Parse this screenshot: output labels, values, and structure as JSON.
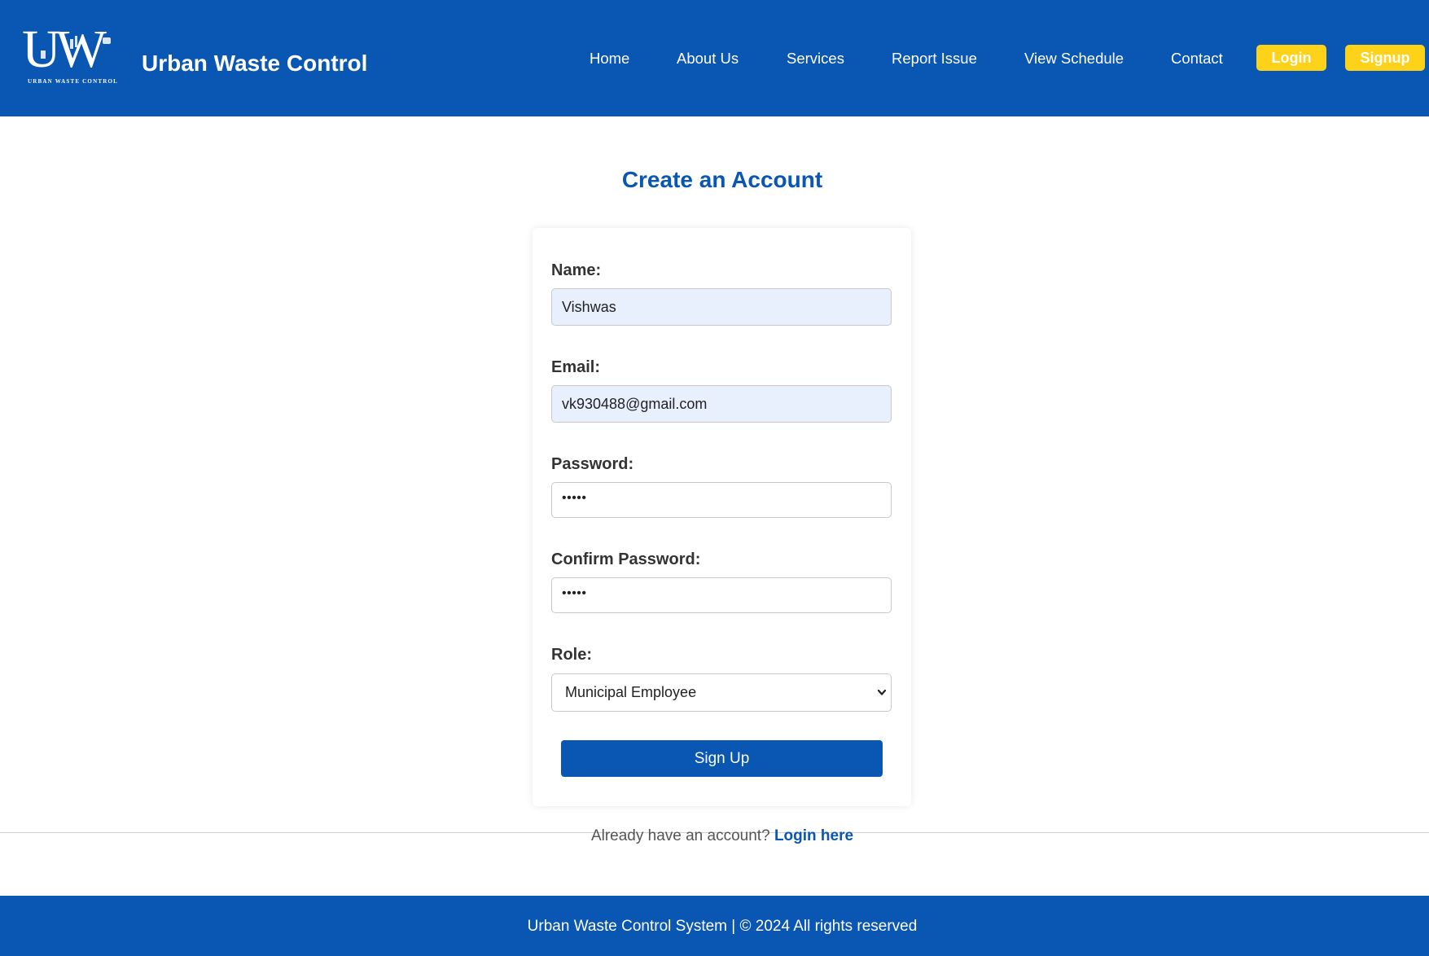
{
  "header": {
    "logo_letters": "UW",
    "logo_subtitle": "URBAN WASTE CONTROL",
    "title": "Urban Waste Control",
    "nav": [
      {
        "label": "Home"
      },
      {
        "label": "About Us"
      },
      {
        "label": "Services"
      },
      {
        "label": "Report Issue"
      },
      {
        "label": "View Schedule"
      },
      {
        "label": "Contact"
      }
    ],
    "login_label": "Login",
    "signup_label": "Signup"
  },
  "main": {
    "title": "Create an Account",
    "form": {
      "name_label": "Name:",
      "name_value": "Vishwas",
      "email_label": "Email:",
      "email_value": "vk930488@gmail.com",
      "password_label": "Password:",
      "password_value": "•••••",
      "confirm_label": "Confirm Password:",
      "confirm_value": "•••••",
      "role_label": "Role:",
      "role_value": "Municipal Employee",
      "submit_label": "Sign Up"
    },
    "login_prompt": "Already have an account?",
    "login_link": "Login here"
  },
  "footer": {
    "text": "Urban Waste Control System | © 2024 All rights reserved"
  },
  "colors": {
    "primary": "#0a56b3",
    "accent": "#ffd21a",
    "autofill_bg": "#e8f0fe"
  },
  "icons": {
    "logo": "uw-logo-icon",
    "select_arrow": "chevron-down-icon"
  }
}
